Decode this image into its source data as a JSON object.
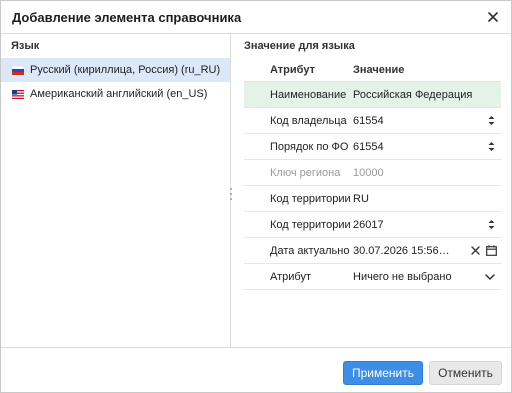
{
  "dialog": {
    "title": "Добавление элемента справочника",
    "close_icon": "close-icon"
  },
  "languages": {
    "header": "Язык",
    "items": [
      {
        "label": "Русский (кириллица, Россия) (ru_RU)",
        "flag": "russia-flag-icon",
        "selected": true
      },
      {
        "label": "Американский английский (en_US)",
        "flag": "usa-flag-icon",
        "selected": false
      }
    ]
  },
  "values": {
    "header": "Значение для языка",
    "columns": {
      "attribute": "Атрибут",
      "value": "Значение"
    },
    "rows": [
      {
        "attribute": "Наименование",
        "value": "Российская Федерация",
        "control": "none",
        "highlight": true,
        "disabled": false
      },
      {
        "attribute": "Код владельца ФО",
        "value": "61554",
        "control": "spinner",
        "highlight": false,
        "disabled": false
      },
      {
        "attribute": "Порядок по ФО",
        "value": "61554",
        "control": "spinner",
        "highlight": false,
        "disabled": false
      },
      {
        "attribute": "Ключ региона",
        "value": "10000",
        "control": "none",
        "highlight": false,
        "disabled": true
      },
      {
        "attribute": "Код территории (ИСО",
        "value": "RU",
        "control": "none",
        "highlight": false,
        "disabled": false
      },
      {
        "attribute": "Код территории",
        "value": "26017",
        "control": "spinner",
        "highlight": false,
        "disabled": false
      },
      {
        "attribute": "Дата актуальности",
        "value": "30.07.2026 15:56…",
        "control": "datetime",
        "highlight": false,
        "disabled": false
      },
      {
        "attribute": "Атрибут",
        "value": "Ничего не выбрано",
        "control": "dropdown",
        "highlight": false,
        "disabled": false
      }
    ]
  },
  "footer": {
    "apply_label": "Применить",
    "cancel_label": "Отменить"
  },
  "colors": {
    "accent": "#3d8ee6",
    "selection": "#dbe8f8",
    "highlight_row": "#e3f3e8"
  }
}
